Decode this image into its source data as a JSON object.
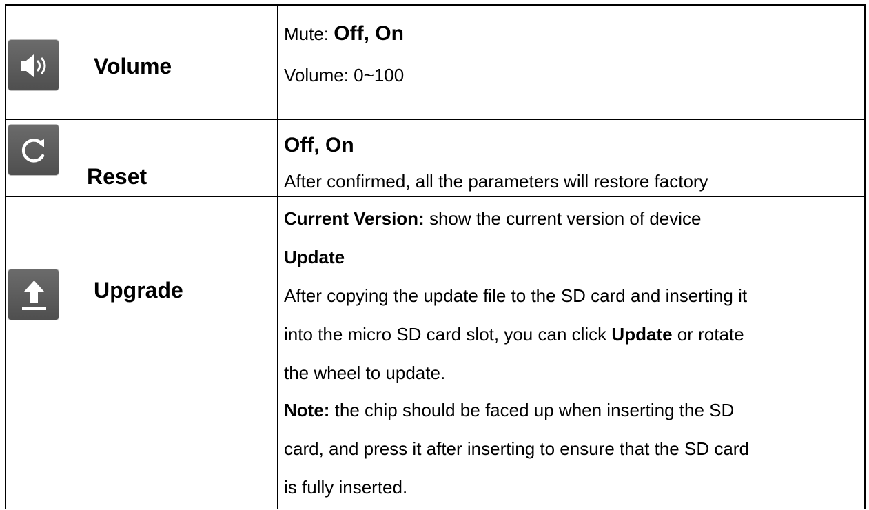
{
  "rows": {
    "volume": {
      "label": "Volume",
      "icon": "speaker-icon",
      "mute_prefix": "Mute:",
      "mute_values": "Off, On",
      "volume_range": "Volume: 0~100"
    },
    "reset": {
      "label": "Reset",
      "icon": "refresh-icon",
      "values": "Off, On",
      "description": "After confirmed, all the parameters will restore factory"
    },
    "upgrade": {
      "label": "Upgrade",
      "icon": "upload-icon",
      "current_version_label": "Current Version:",
      "current_version_text": "show the current version of device",
      "update_heading": "Update",
      "update_line1": "After copying the update file to the SD card and inserting it",
      "update_line2_pre": "into the micro SD card slot, you can click",
      "update_line2_bold": "Update",
      "update_line2_post": "or rotate",
      "update_line3": "the wheel to update.",
      "note_label": "Note:",
      "note_line1": "the chip should be faced up when inserting the SD",
      "note_line2": "card, and press it after inserting to ensure that the SD card",
      "note_line3": "is fully inserted."
    }
  },
  "colors": {
    "icon_background": "#5a5a5a",
    "icon_foreground": "#ffffff",
    "border": "#000000"
  }
}
